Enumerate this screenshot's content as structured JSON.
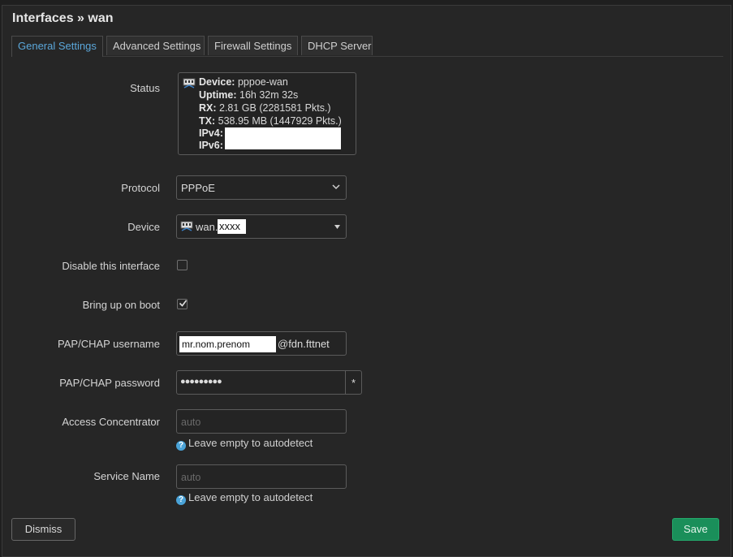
{
  "header": {
    "title": "Interfaces » wan"
  },
  "tabs": [
    {
      "label": "General Settings",
      "active": true
    },
    {
      "label": "Advanced Settings",
      "active": false
    },
    {
      "label": "Firewall Settings",
      "active": false
    },
    {
      "label": "DHCP Server",
      "active": false
    }
  ],
  "status": {
    "label": "Status",
    "device_key": "Device:",
    "device_val": " pppoe-wan",
    "uptime_key": "Uptime:",
    "uptime_val": " 16h 32m 32s",
    "rx_key": "RX:",
    "rx_val": " 2.81 GB (2281581 Pkts.)",
    "tx_key": "TX:",
    "tx_val": " 538.95 MB (1447929 Pkts.)",
    "ipv4_key": "IPv4:",
    "ipv6_key": "IPv6:"
  },
  "protocol": {
    "label": "Protocol",
    "value": "PPPoE"
  },
  "device": {
    "label": "Device",
    "prefix": "wan.",
    "suffix": "xxxx"
  },
  "disable_interface": {
    "label": "Disable this interface",
    "checked": false
  },
  "bring_up_on_boot": {
    "label": "Bring up on boot",
    "checked": true
  },
  "username": {
    "label": "PAP/CHAP username",
    "value": "mr.nom.prenom",
    "suffix": "@fdn.fttnet"
  },
  "password": {
    "label": "PAP/CHAP password",
    "value": "●●●●●●●●●",
    "reveal": "*"
  },
  "access_concentrator": {
    "label": "Access Concentrator",
    "placeholder": "auto",
    "hint": "Leave empty to autodetect"
  },
  "service_name": {
    "label": "Service Name",
    "placeholder": "auto",
    "hint": "Leave empty to autodetect"
  },
  "footer": {
    "dismiss": "Dismiss",
    "save": "Save"
  },
  "colors": {
    "accent": "#5ba7da",
    "save": "#1a8f5a",
    "help": "#4aa3d8"
  },
  "icons": [
    "network-port-icon",
    "chevron-down-icon",
    "caret-down-icon",
    "checkmark-icon",
    "help-icon"
  ]
}
